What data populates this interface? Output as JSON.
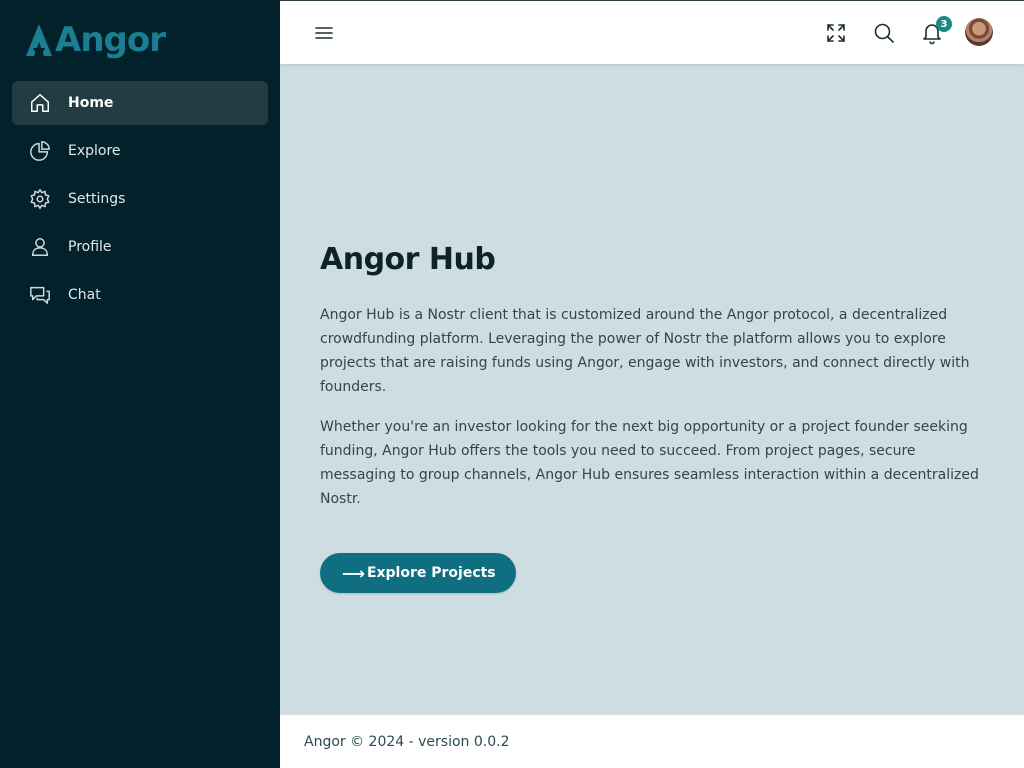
{
  "brand": {
    "name": "Angor"
  },
  "sidebar": {
    "items": [
      {
        "label": "Home",
        "icon": "home-icon",
        "active": true
      },
      {
        "label": "Explore",
        "icon": "pie-chart-icon",
        "active": false
      },
      {
        "label": "Settings",
        "icon": "gear-icon",
        "active": false
      },
      {
        "label": "Profile",
        "icon": "user-icon",
        "active": false
      },
      {
        "label": "Chat",
        "icon": "chat-icon",
        "active": false
      }
    ]
  },
  "header": {
    "menu_icon": "hamburger-icon",
    "fullscreen_icon": "expand-icon",
    "search_icon": "search-icon",
    "notifications_icon": "bell-icon",
    "notifications_count": "3"
  },
  "main": {
    "title": "Angor Hub",
    "paragraph1": "Angor Hub is a Nostr client that is customized around the Angor protocol, a decentralized crowdfunding platform. Leveraging the power of Nostr the platform allows you to explore projects that are raising funds using Angor, engage with investors, and connect directly with founders.",
    "paragraph2": "Whether you're an investor looking for the next big opportunity or a project founder seeking funding, Angor Hub offers the tools you need to succeed. From project pages, secure messaging to group channels, Angor Hub ensures seamless interaction within a decentralized Nostr.",
    "cta_arrow": "⟶",
    "cta_label": "Explore Projects"
  },
  "footer": {
    "text": "Angor © 2024 - version 0.0.2"
  },
  "colors": {
    "sidebar_bg": "#03212b",
    "accent": "#0f6e80",
    "content_bg": "#cddde2",
    "badge": "#1a8a85"
  }
}
